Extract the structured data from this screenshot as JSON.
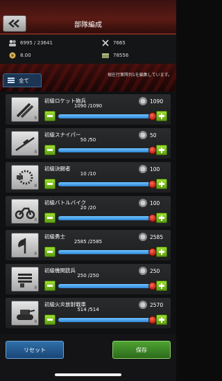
{
  "header": {
    "title": "部隊編成",
    "back_icon": "double-chevron-left-icon"
  },
  "stats": {
    "capacity": "6995 / 23641",
    "power": "7665",
    "cost": "8.00",
    "resource": "78556"
  },
  "banner": {
    "message": "現在行軍隊列1を編集しています。"
  },
  "filter": {
    "label": "全て"
  },
  "units": [
    {
      "name": "初級ロケット砲兵",
      "count": "1090 /1090",
      "cost": "1090",
      "tier": "II",
      "fill": 1.0,
      "icon": "rocket-launcher-icon"
    },
    {
      "name": "初級スナイパー",
      "count": "50 /50",
      "cost": "50",
      "tier": "II",
      "fill": 1.0,
      "icon": "sniper-rifle-icon"
    },
    {
      "name": "初級決闘者",
      "count": "10 /10",
      "cost": "100",
      "tier": "II",
      "fill": 1.0,
      "icon": "chainsaw-icon"
    },
    {
      "name": "初級バトルバイク",
      "count": "20 /20",
      "cost": "100",
      "tier": "II",
      "fill": 1.0,
      "icon": "motorbike-icon"
    },
    {
      "name": "初級勇士",
      "count": "2585 /2585",
      "cost": "2585",
      "tier": "II",
      "fill": 1.0,
      "icon": "axe-icon"
    },
    {
      "name": "初級機関銃兵",
      "count": "250 /250",
      "cost": "250",
      "tier": "II",
      "fill": 1.0,
      "icon": "gatling-gun-icon"
    },
    {
      "name": "初級火炎放射戦車",
      "count": "514 /514",
      "cost": "2570",
      "tier": "II",
      "fill": 1.0,
      "icon": "tank-icon"
    }
  ],
  "footer": {
    "reset_label": "リセット",
    "save_label": "保存"
  }
}
